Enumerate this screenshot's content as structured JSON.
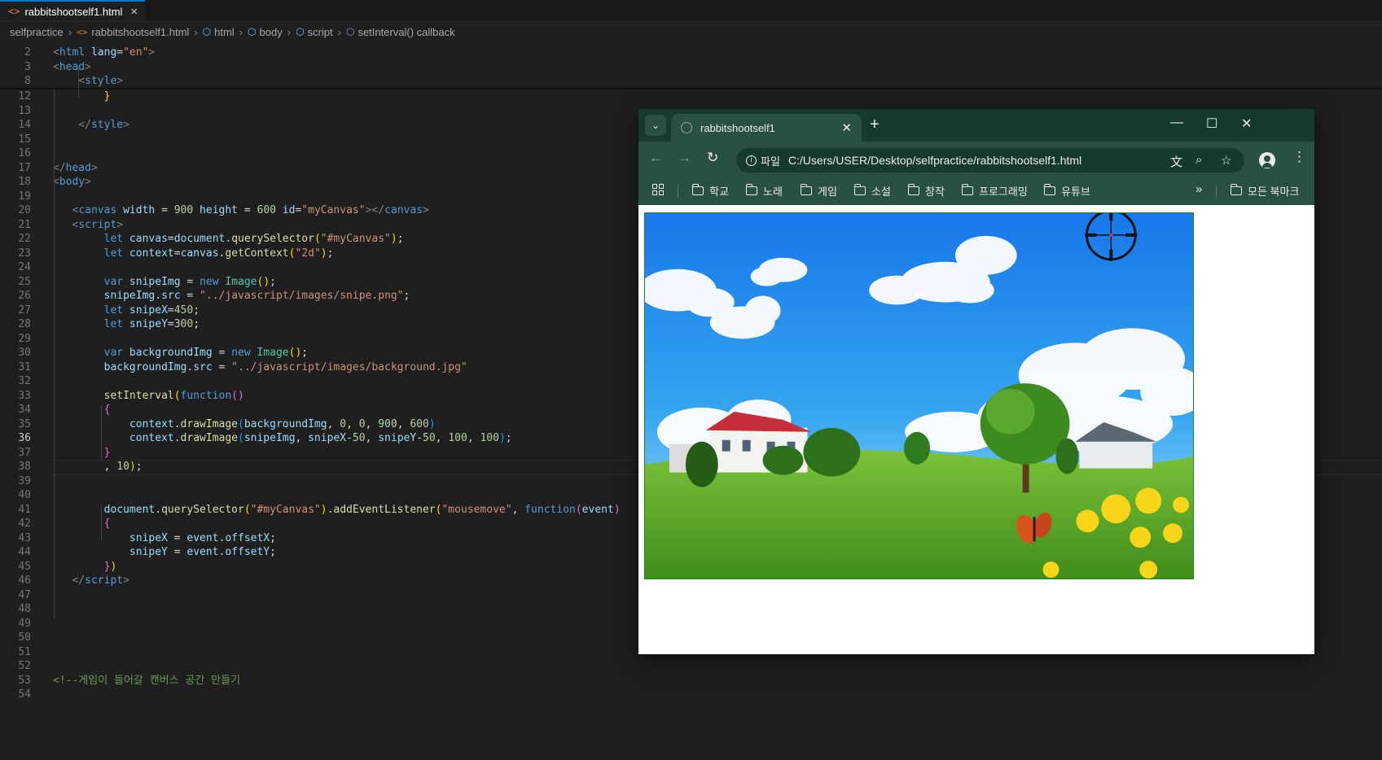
{
  "editor": {
    "tab_label": "rabbitshootself1.html",
    "tab_icon": "<>",
    "tab_close": "×",
    "breadcrumbs": [
      "selfpractice",
      "rabbitshootself1.html",
      "html",
      "body",
      "script",
      "setInterval() callback"
    ]
  },
  "code_lines": [
    {
      "n": "2",
      "t": ""
    },
    {
      "n": "3",
      "t": ""
    },
    {
      "n": "8",
      "t": ""
    },
    {
      "n": "12",
      "t": ""
    },
    {
      "n": "13",
      "t": ""
    },
    {
      "n": "14",
      "t": ""
    },
    {
      "n": "15",
      "t": ""
    },
    {
      "n": "16",
      "t": ""
    },
    {
      "n": "17",
      "t": ""
    },
    {
      "n": "18",
      "t": ""
    },
    {
      "n": "19",
      "t": ""
    },
    {
      "n": "20",
      "t": ""
    },
    {
      "n": "21",
      "t": ""
    },
    {
      "n": "22",
      "t": ""
    },
    {
      "n": "23",
      "t": ""
    },
    {
      "n": "24",
      "t": ""
    },
    {
      "n": "25",
      "t": ""
    },
    {
      "n": "26",
      "t": ""
    },
    {
      "n": "27",
      "t": ""
    },
    {
      "n": "28",
      "t": ""
    },
    {
      "n": "29",
      "t": ""
    },
    {
      "n": "30",
      "t": ""
    },
    {
      "n": "31",
      "t": ""
    },
    {
      "n": "32",
      "t": ""
    },
    {
      "n": "33",
      "t": ""
    },
    {
      "n": "34",
      "t": ""
    },
    {
      "n": "35",
      "t": ""
    },
    {
      "n": "36",
      "t": ""
    },
    {
      "n": "37",
      "t": ""
    },
    {
      "n": "38",
      "t": ""
    },
    {
      "n": "39",
      "t": ""
    },
    {
      "n": "40",
      "t": ""
    },
    {
      "n": "41",
      "t": ""
    },
    {
      "n": "42",
      "t": ""
    },
    {
      "n": "43",
      "t": ""
    },
    {
      "n": "44",
      "t": ""
    },
    {
      "n": "45",
      "t": ""
    },
    {
      "n": "46",
      "t": ""
    },
    {
      "n": "47",
      "t": ""
    },
    {
      "n": "48",
      "t": ""
    },
    {
      "n": "49",
      "t": ""
    },
    {
      "n": "50",
      "t": ""
    },
    {
      "n": "51",
      "t": ""
    },
    {
      "n": "52",
      "t": ""
    },
    {
      "n": "53",
      "t": ""
    },
    {
      "n": "54",
      "t": ""
    }
  ],
  "code_text": {
    "l2": [
      [
        "tgb",
        "<"
      ],
      [
        "tg",
        "html"
      ],
      [
        "at",
        " lang"
      ],
      [
        "pn",
        "="
      ],
      [
        "st",
        "\"en\""
      ],
      [
        "tgb",
        ">"
      ]
    ],
    "l3": [
      [
        "tgb",
        "<"
      ],
      [
        "tg",
        "head"
      ],
      [
        "tgb",
        ">"
      ]
    ],
    "l8": [
      [
        "pn",
        "    "
      ],
      [
        "tgb",
        "<"
      ],
      [
        "tg",
        "style"
      ],
      [
        "tgb",
        ">"
      ]
    ],
    "l12": [
      [
        "pn",
        "        "
      ],
      [
        "b1",
        "}"
      ]
    ],
    "l13": [],
    "l14": [
      [
        "pn",
        "    "
      ],
      [
        "tgb",
        "</"
      ],
      [
        "tg",
        "style"
      ],
      [
        "tgb",
        ">"
      ]
    ],
    "l15": [],
    "l16": [],
    "l17": [
      [
        "tgb",
        "</"
      ],
      [
        "tg",
        "head"
      ],
      [
        "tgb",
        ">"
      ]
    ],
    "l18": [
      [
        "tgb",
        "<"
      ],
      [
        "tg",
        "body"
      ],
      [
        "tgb",
        ">"
      ]
    ],
    "l19": [],
    "l20": [
      [
        "pn",
        "   "
      ],
      [
        "tgb",
        "<"
      ],
      [
        "tg",
        "canvas"
      ],
      [
        "at",
        " width"
      ],
      [
        "pn",
        " = "
      ],
      [
        "nm",
        "900"
      ],
      [
        "at",
        " height"
      ],
      [
        "pn",
        " = "
      ],
      [
        "nm",
        "600"
      ],
      [
        "at",
        " id"
      ],
      [
        "pn",
        "="
      ],
      [
        "st",
        "\"myCanvas\""
      ],
      [
        "tgb",
        "></"
      ],
      [
        "tg",
        "canvas"
      ],
      [
        "tgb",
        ">"
      ]
    ],
    "l21": [
      [
        "pn",
        "   "
      ],
      [
        "tgb",
        "<"
      ],
      [
        "tg",
        "script"
      ],
      [
        "tgb",
        ">"
      ]
    ],
    "l22": [
      [
        "pn",
        "        "
      ],
      [
        "kw",
        "let"
      ],
      [
        "vr",
        " canvas"
      ],
      [
        "pn",
        "="
      ],
      [
        "vr",
        "document"
      ],
      [
        "pn",
        "."
      ],
      [
        "fn",
        "querySelector"
      ],
      [
        "b1",
        "("
      ],
      [
        "st",
        "\"#myCanvas\""
      ],
      [
        "b1",
        ")"
      ],
      [
        "pn",
        ";"
      ]
    ],
    "l23": [
      [
        "pn",
        "        "
      ],
      [
        "kw",
        "let"
      ],
      [
        "vr",
        " context"
      ],
      [
        "pn",
        "="
      ],
      [
        "vr",
        "canvas"
      ],
      [
        "pn",
        "."
      ],
      [
        "fn",
        "getContext"
      ],
      [
        "b1",
        "("
      ],
      [
        "st",
        "\"2d\""
      ],
      [
        "b1",
        ")"
      ],
      [
        "pn",
        ";"
      ]
    ],
    "l24": [],
    "l25": [
      [
        "pn",
        "        "
      ],
      [
        "kw",
        "var"
      ],
      [
        "vr",
        " snipeImg"
      ],
      [
        "pn",
        " = "
      ],
      [
        "kw",
        "new"
      ],
      [
        "cl",
        " Image"
      ],
      [
        "b1",
        "()"
      ],
      [
        "pn",
        ";"
      ]
    ],
    "l26": [
      [
        "pn",
        "        "
      ],
      [
        "vr",
        "snipeImg"
      ],
      [
        "pn",
        "."
      ],
      [
        "vr",
        "src"
      ],
      [
        "pn",
        " = "
      ],
      [
        "st",
        "\"../javascript/images/snipe.png\""
      ],
      [
        "pn",
        ";"
      ]
    ],
    "l27": [
      [
        "pn",
        "        "
      ],
      [
        "kw",
        "let"
      ],
      [
        "vr",
        " snipeX"
      ],
      [
        "pn",
        "="
      ],
      [
        "nm",
        "450"
      ],
      [
        "pn",
        ";"
      ]
    ],
    "l28": [
      [
        "pn",
        "        "
      ],
      [
        "kw",
        "let"
      ],
      [
        "vr",
        " snipeY"
      ],
      [
        "pn",
        "="
      ],
      [
        "nm",
        "300"
      ],
      [
        "pn",
        ";"
      ]
    ],
    "l29": [],
    "l30": [
      [
        "pn",
        "        "
      ],
      [
        "kw",
        "var"
      ],
      [
        "vr",
        " backgroundImg"
      ],
      [
        "pn",
        " = "
      ],
      [
        "kw",
        "new"
      ],
      [
        "cl",
        " Image"
      ],
      [
        "b1",
        "()"
      ],
      [
        "pn",
        ";"
      ]
    ],
    "l31": [
      [
        "pn",
        "        "
      ],
      [
        "vr",
        "backgroundImg"
      ],
      [
        "pn",
        "."
      ],
      [
        "vr",
        "src"
      ],
      [
        "pn",
        " = "
      ],
      [
        "st",
        "\"../javascript/images/background.jpg\""
      ]
    ],
    "l32": [],
    "l33": [
      [
        "pn",
        "        "
      ],
      [
        "fn",
        "setInterval"
      ],
      [
        "b1",
        "("
      ],
      [
        "kw",
        "function"
      ],
      [
        "b2",
        "()"
      ]
    ],
    "l34": [
      [
        "pn",
        "        "
      ],
      [
        "b2",
        "{"
      ]
    ],
    "l35": [
      [
        "pn",
        "            "
      ],
      [
        "vr",
        "context"
      ],
      [
        "pn",
        "."
      ],
      [
        "fn",
        "drawImage"
      ],
      [
        "b3",
        "("
      ],
      [
        "vr",
        "backgroundImg"
      ],
      [
        "pn",
        ", "
      ],
      [
        "nm",
        "0"
      ],
      [
        "pn",
        ", "
      ],
      [
        "nm",
        "0"
      ],
      [
        "pn",
        ", "
      ],
      [
        "nm",
        "900"
      ],
      [
        "pn",
        ", "
      ],
      [
        "nm",
        "600"
      ],
      [
        "b3",
        ")"
      ]
    ],
    "l36": [
      [
        "pn",
        "            "
      ],
      [
        "vr",
        "context"
      ],
      [
        "pn",
        "."
      ],
      [
        "fn",
        "drawImage"
      ],
      [
        "b3",
        "("
      ],
      [
        "vr",
        "snipeImg"
      ],
      [
        "pn",
        ", "
      ],
      [
        "vr",
        "snipeX"
      ],
      [
        "pn",
        "-"
      ],
      [
        "nm",
        "50"
      ],
      [
        "pn",
        ", "
      ],
      [
        "vr",
        "snipeY"
      ],
      [
        "pn",
        "-"
      ],
      [
        "nm",
        "50"
      ],
      [
        "pn",
        ", "
      ],
      [
        "nm",
        "100"
      ],
      [
        "pn",
        ", "
      ],
      [
        "nm",
        "100"
      ],
      [
        "b3",
        ")"
      ],
      [
        "pn",
        ";"
      ]
    ],
    "l37": [
      [
        "pn",
        "        "
      ],
      [
        "b2",
        "}"
      ]
    ],
    "l38": [
      [
        "pn",
        "        , "
      ],
      [
        "nm",
        "10"
      ],
      [
        "b1",
        ")"
      ],
      [
        "pn",
        ";"
      ]
    ],
    "l39": [],
    "l40": [],
    "l41": [
      [
        "pn",
        "        "
      ],
      [
        "vr",
        "document"
      ],
      [
        "pn",
        "."
      ],
      [
        "fn",
        "querySelector"
      ],
      [
        "b1",
        "("
      ],
      [
        "st",
        "\"#myCanvas\""
      ],
      [
        "b1",
        ")"
      ],
      [
        "pn",
        "."
      ],
      [
        "fn",
        "addEventListener"
      ],
      [
        "b1",
        "("
      ],
      [
        "st",
        "\"mousemove\""
      ],
      [
        "pn",
        ", "
      ],
      [
        "kw",
        "function"
      ],
      [
        "b2",
        "("
      ],
      [
        "vr",
        "event"
      ],
      [
        "b2",
        ")"
      ]
    ],
    "l42": [
      [
        "pn",
        "        "
      ],
      [
        "b2",
        "{"
      ]
    ],
    "l43": [
      [
        "pn",
        "            "
      ],
      [
        "vr",
        "snipeX"
      ],
      [
        "pn",
        " = "
      ],
      [
        "vr",
        "event"
      ],
      [
        "pn",
        "."
      ],
      [
        "vr",
        "offsetX"
      ],
      [
        "pn",
        ";"
      ]
    ],
    "l44": [
      [
        "pn",
        "            "
      ],
      [
        "vr",
        "snipeY"
      ],
      [
        "pn",
        " = "
      ],
      [
        "vr",
        "event"
      ],
      [
        "pn",
        "."
      ],
      [
        "vr",
        "offsetY"
      ],
      [
        "pn",
        ";"
      ]
    ],
    "l45": [
      [
        "pn",
        "        "
      ],
      [
        "b2",
        "}"
      ],
      [
        "b1",
        ")"
      ]
    ],
    "l46": [
      [
        "pn",
        "   "
      ],
      [
        "tgb",
        "</"
      ],
      [
        "tg",
        "script"
      ],
      [
        "tgb",
        ">"
      ]
    ],
    "l47": [],
    "l48": [],
    "l49": [],
    "l50": [],
    "l51": [],
    "l52": [],
    "l53": [
      [
        "cm",
        "<!--게임이 들어갈 캔버스 공간 만들기"
      ]
    ],
    "l54": []
  },
  "active_line": "36",
  "browser": {
    "tab_title": "rabbitshootself1",
    "tab_close": "✕",
    "new_tab": "+",
    "minimize": "—",
    "maximize": "☐",
    "close": "✕",
    "back": "←",
    "forward": "→",
    "reload": "↻",
    "site_chip": "파일",
    "url": "C:/Users/USER/Desktop/selfpractice/rabbitshootself1.html",
    "translate_icon": "文",
    "zoom_icon": "⌕",
    "star_icon": "☆",
    "menu_icon": "⋮",
    "bookmarks": [
      "학교",
      "노래",
      "게임",
      "소설",
      "창작",
      "프로그래밍",
      "유튜브"
    ],
    "more_bookmarks": "»",
    "all_bookmarks": "모든 북마크"
  },
  "colors": {
    "editor_bg": "#1f1f1f",
    "browser_frame": "#2a5041",
    "browser_tabstrip": "#173a2e",
    "canvas_border": "#1e8a1e"
  }
}
